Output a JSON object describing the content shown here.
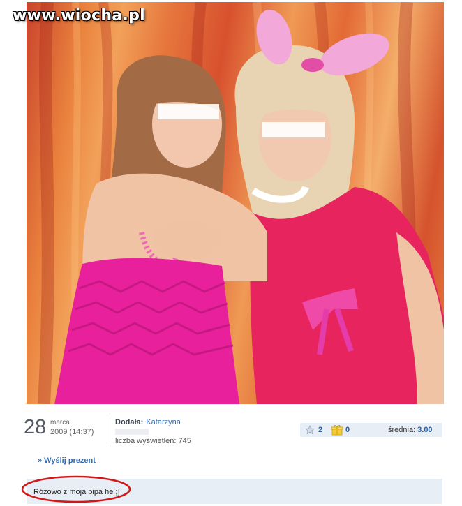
{
  "watermark": {
    "text": "www.wiocha.pl"
  },
  "photo": {
    "alt": "photo"
  },
  "date": {
    "day": "28",
    "month": "marca",
    "year_time": "2009 (14:37)"
  },
  "meta": {
    "added_label": "Dodała:",
    "author": "Katarzyna",
    "views_label": "liczba wyświetleń:",
    "views": "745"
  },
  "stats": {
    "star_icon": "star-icon",
    "star_count": "2",
    "gift_icon": "gift-icon",
    "gift_count": "0",
    "rating_label": "średnia:",
    "rating_value": "3.00"
  },
  "actions": {
    "send_gift": "» Wyślij prezent"
  },
  "comment": {
    "text": "Różowo z moja pipa he ;]"
  },
  "colors": {
    "link": "#2e6cb5",
    "panel_bg": "#e8eef5",
    "annotation_red": "#d01818"
  }
}
